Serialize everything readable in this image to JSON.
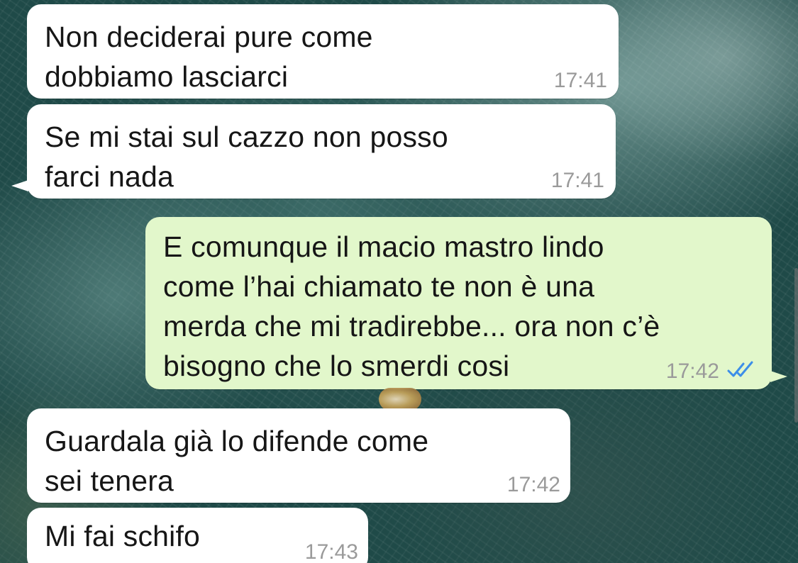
{
  "chat": {
    "messages": [
      {
        "id": "m1",
        "direction": "incoming",
        "text": "Non deciderai pure come\ndobbiamo lasciarci",
        "time": "17:41"
      },
      {
        "id": "m2",
        "direction": "incoming",
        "text": "Se mi stai sul cazzo non posso\nfarci nada",
        "time": "17:41"
      },
      {
        "id": "m3",
        "direction": "outgoing",
        "text": "E comunque il macio mastro lindo\ncome l’hai chiamato te non è una\nmerda che mi tradirebbe... ora non c’è\nbisogno che lo smerdi cosi",
        "time": "17:42",
        "status_icon": "double-check-read-icon"
      },
      {
        "id": "m4",
        "direction": "incoming",
        "text": "Guardala già lo difende come\nsei tenera",
        "time": "17:42"
      },
      {
        "id": "m5",
        "direction": "incoming",
        "text": "Mi fai schifo",
        "time": "17:43"
      }
    ]
  },
  "colors": {
    "incoming_bubble": "#ffffff",
    "outgoing_bubble": "#e2f7cb",
    "read_ticks": "#3c8ee8",
    "timestamp": "#9a9a9a"
  }
}
